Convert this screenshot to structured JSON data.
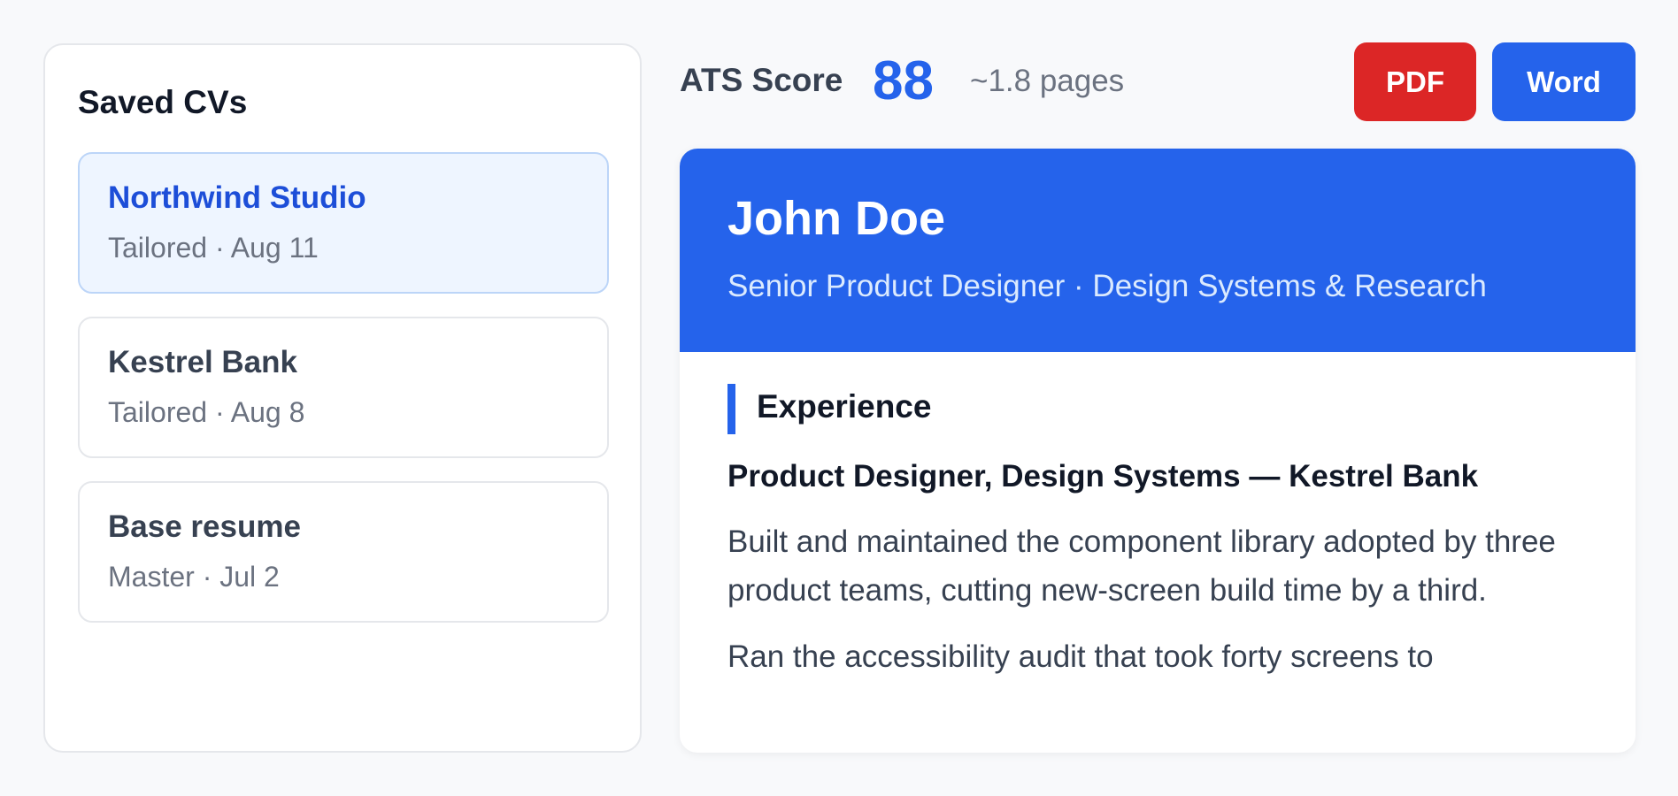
{
  "sidebar": {
    "title": "Saved CVs",
    "items": [
      {
        "name": "Northwind Studio",
        "meta": "Tailored · Aug 11"
      },
      {
        "name": "Kestrel Bank",
        "meta": "Tailored · Aug 8"
      },
      {
        "name": "Base resume",
        "meta": "Master · Jul 2"
      }
    ]
  },
  "toolbar": {
    "ats_label": "ATS Score",
    "ats_score": "88",
    "pages": "~1.8 pages",
    "pdf_label": "PDF",
    "word_label": "Word"
  },
  "cv": {
    "name": "John Doe",
    "headline": "Senior Product Designer · Design Systems & Research",
    "section_experience": "Experience",
    "job_title": "Product Designer, Design Systems — Kestrel Bank",
    "bullets": [
      "Built and maintained the component library adopted by three product teams, cutting new-screen build time by a third.",
      "Ran the accessibility audit that took forty screens to"
    ]
  },
  "colors": {
    "accent": "#2563eb",
    "pdf": "#dc2626",
    "active_item_bg": "#eef5ff"
  }
}
